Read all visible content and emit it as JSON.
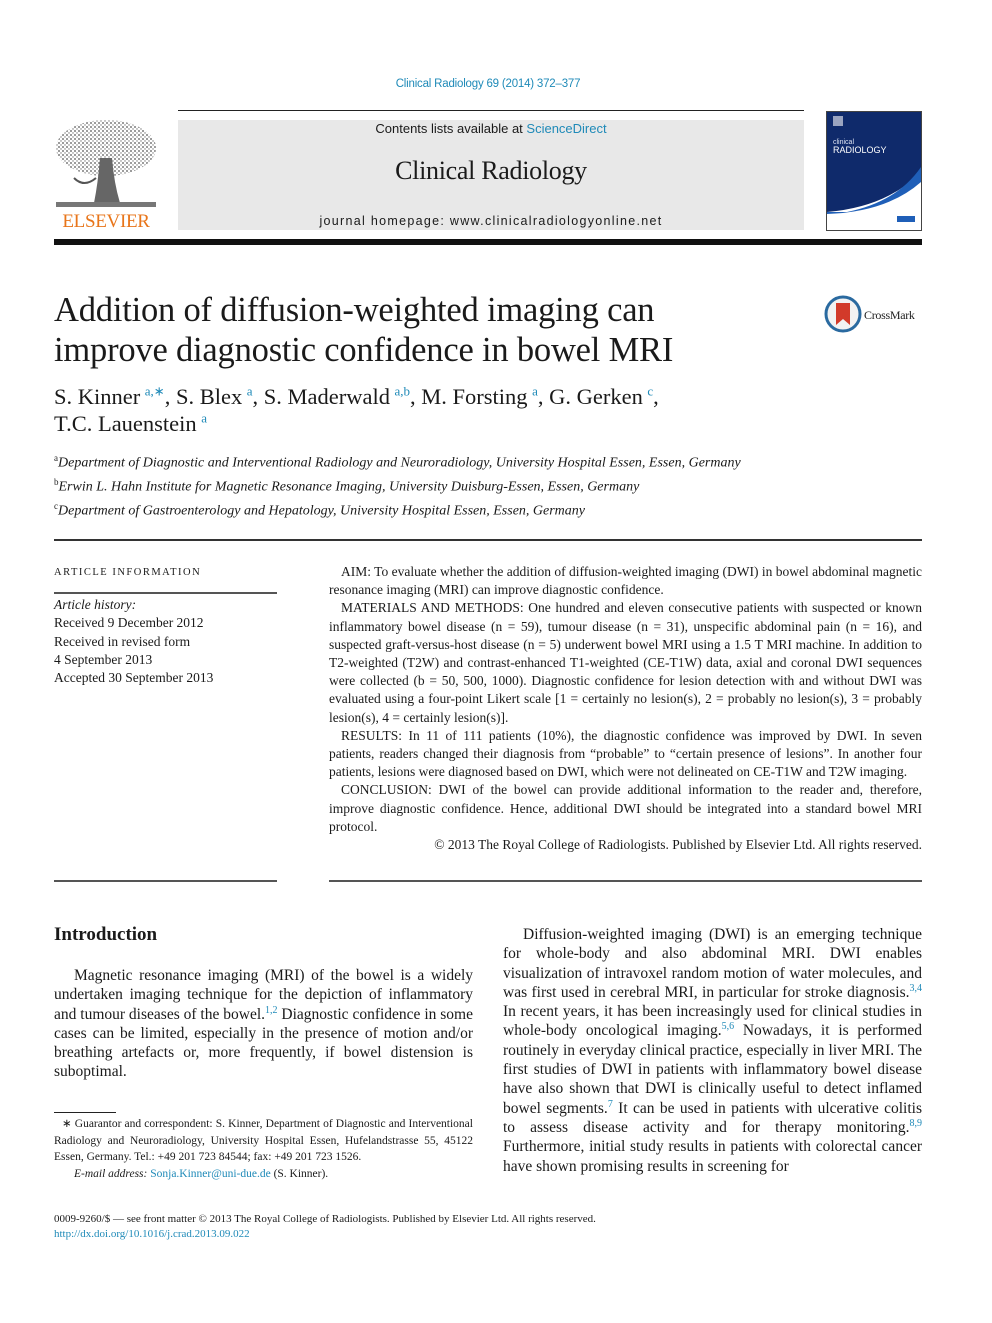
{
  "header": {
    "citation": "Clinical Radiology 69 (2014) 372–377",
    "contents_prefix": "Contents lists available at ",
    "contents_link": "ScienceDirect",
    "journal_name": "Clinical Radiology",
    "homepage": "journal homepage: www.clinicalradiologyonline.net",
    "publisher_logo_text": "ELSEVIER",
    "cover_title_small": "clinical",
    "cover_title_large": "RADIOLOGY",
    "colors": {
      "link": "#1f8ab8",
      "elsevier_orange": "#e8751a",
      "cover_blue": "#0f2a6b",
      "cover_stripe": "#1f5fb8",
      "masthead_bg": "#e8e8e8"
    }
  },
  "article": {
    "title_line1": "Addition of diffusion-weighted imaging can",
    "title_line2": "improve diagnostic confidence in bowel MRI",
    "crossmark_label": "CrossMark",
    "authors": [
      {
        "name": "S. Kinner",
        "sup": "a,∗",
        "sep": ", "
      },
      {
        "name": "S. Blex",
        "sup": "a",
        "sep": ", "
      },
      {
        "name": "S. Maderwald",
        "sup": "a,b",
        "sep": ", "
      },
      {
        "name": "M. Forsting",
        "sup": "a",
        "sep": ", "
      },
      {
        "name": "G. Gerken",
        "sup": "c",
        "sep": ","
      },
      {
        "name": "T.C. Lauenstein",
        "sup": "a",
        "sep": ""
      }
    ],
    "affiliations": [
      {
        "key": "a",
        "text": "Department of Diagnostic and Interventional Radiology and Neuroradiology, University Hospital Essen, Essen, Germany"
      },
      {
        "key": "b",
        "text": "Erwin L. Hahn Institute for Magnetic Resonance Imaging, University Duisburg-Essen, Essen, Germany"
      },
      {
        "key": "c",
        "text": "Department of Gastroenterology and Hepatology, University Hospital Essen, Essen, Germany"
      }
    ]
  },
  "article_info": {
    "heading": "ARTICLE INFORMATION",
    "history_label": "Article history:",
    "history": [
      "Received 9 December 2012",
      "Received in revised form",
      "4 September 2013",
      "Accepted 30 September 2013"
    ]
  },
  "abstract": {
    "aim": "AIM: To evaluate whether the addition of diffusion-weighted imaging (DWI) in bowel abdominal magnetic resonance imaging (MRI) can improve diagnostic confidence.",
    "methods": "MATERIALS AND METHODS: One hundred and eleven consecutive patients with suspected or known inflammatory bowel disease (n = 59), tumour disease (n = 31), unspecific abdominal pain (n = 16), and suspected graft-versus-host disease (n = 5) underwent bowel MRI using a 1.5 T MRI machine. In addition to T2-weighted (T2W) and contrast-enhanced T1-weighted (CE-T1W) data, axial and coronal DWI sequences were collected (b = 50, 500, 1000). Diagnostic confidence for lesion detection with and without DWI was evaluated using a four-point Likert scale [1 = certainly no lesion(s), 2 = probably no lesion(s), 3 = probably lesion(s), 4 = certainly lesion(s)].",
    "results": "RESULTS: In 11 of 111 patients (10%), the diagnostic confidence was improved by DWI. In seven patients, readers changed their diagnosis from “probable” to “certain presence of lesions”. In another four patients, lesions were diagnosed based on DWI, which were not delineated on CE-T1W and T2W imaging.",
    "conclusion": "CONCLUSION: DWI of the bowel can provide additional information to the reader and, therefore, improve diagnostic confidence. Hence, additional DWI should be integrated into a standard bowel MRI protocol.",
    "copyright": "© 2013 The Royal College of Radiologists. Published by Elsevier Ltd. All rights reserved."
  },
  "introduction": {
    "heading": "Introduction",
    "left_p1_a": "Magnetic resonance imaging (MRI) of the bowel is a widely undertaken imaging technique for the depiction of inflammatory and tumour diseases of the bowel.",
    "left_p1_ref": "1,2",
    "left_p1_b": " Diagnostic confidence in some cases can be limited, especially in the presence of motion and/or breathing artefacts or, more frequently, if bowel distension is suboptimal.",
    "right_a": "Diffusion-weighted imaging (DWI) is an emerging technique for whole-body and also abdominal MRI. DWI enables visualization of intravoxel random motion of water molecules, and was first used in cerebral MRI, in particular for stroke diagnosis.",
    "right_ref1": "3,4",
    "right_b": " In recent years, it has been increasingly used for clinical studies in whole-body oncological imaging.",
    "right_ref2": "5,6",
    "right_c": " Nowadays, it is performed routinely in everyday clinical practice, especially in liver MRI. The first studies of DWI in patients with inflammatory bowel disease have also shown that DWI is clinically useful to detect inflamed bowel segments.",
    "right_ref3": "7",
    "right_d": " It can be used in patients with ulcerative colitis to assess disease activity and for therapy monitoring.",
    "right_ref4": "8,9",
    "right_e": " Furthermore, initial study results in patients with colorectal cancer have shown promising results in screening for"
  },
  "footnote": {
    "marker": "∗",
    "text": " Guarantor and correspondent: S. Kinner, Department of Diagnostic and Interventional Radiology and Neuroradiology, University Hospital Essen, Hufelandstrasse 55, 45122 Essen, Germany. Tel.: +49 201 723 84544; fax: +49 201 723 1526.",
    "email_label": "E-mail address: ",
    "email": "Sonja.Kinner@uni-due.de",
    "email_suffix": " (S. Kinner)."
  },
  "front_matter": {
    "issn_line": "0009-9260/$ — see front matter © 2013 The Royal College of Radiologists. Published by Elsevier Ltd. All rights reserved.",
    "doi": "http://dx.doi.org/10.1016/j.crad.2013.09.022"
  }
}
